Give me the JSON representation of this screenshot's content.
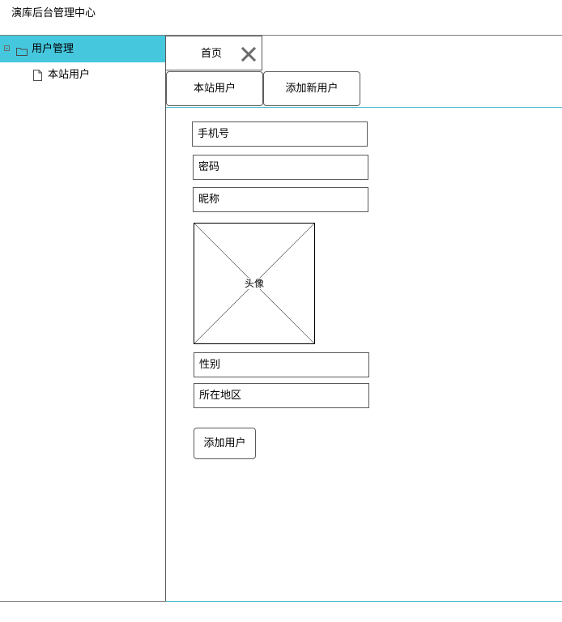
{
  "app": {
    "title": "演库后台管理中心"
  },
  "sidebar": {
    "group": {
      "label": "用户管理",
      "icon": "folder-icon",
      "toggle_icon": "collapse-icon"
    },
    "items": [
      {
        "label": "本站用户",
        "icon": "file-icon"
      }
    ]
  },
  "tabs": [
    {
      "label": "首页",
      "close_icon": "close-icon"
    }
  ],
  "subtabs": [
    {
      "label": "本站用户"
    },
    {
      "label": "添加新用户"
    }
  ],
  "form": {
    "phone_placeholder": "手机号",
    "password_placeholder": "密码",
    "nickname_placeholder": "昵称",
    "avatar_label": "头像",
    "gender_placeholder": "性别",
    "region_placeholder": "所在地区",
    "submit_label": "添加用户"
  },
  "colors": {
    "accent": "#45c8de",
    "border": "#5b5b5b",
    "rule": "#42b7c4"
  }
}
